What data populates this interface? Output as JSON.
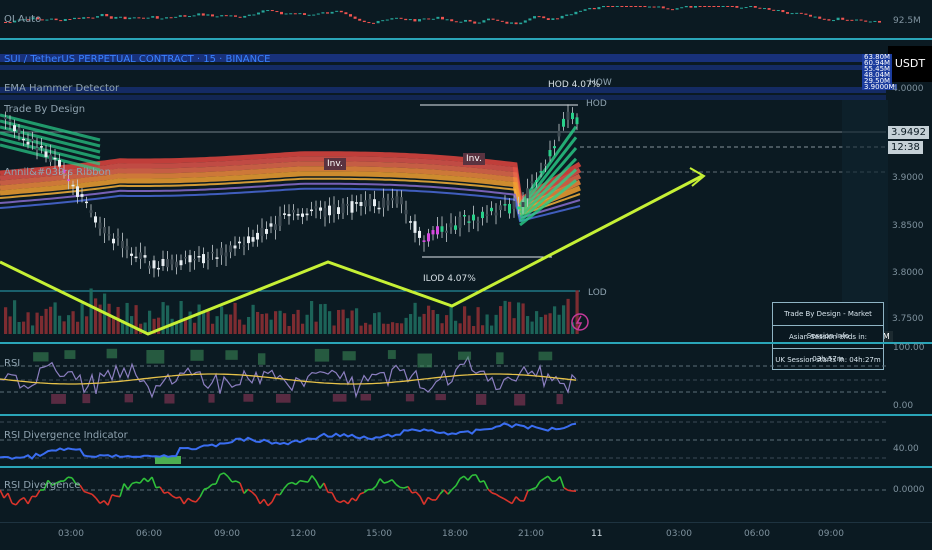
{
  "oi_pane": {
    "title": "OI Auto",
    "value": "92.5M"
  },
  "main": {
    "symbol_title": "SUI / TetherUS PERPETUAL CONTRACT · 15 · BINANCE",
    "currency_button": "USDT",
    "indicator_1": "EMA Hammer Detector",
    "indicator_2": "Trade By Design",
    "indicator_3": "Annil&#039;s Ribbon",
    "hod_label": "HOD",
    "how_label": "HOW",
    "lod_label": "LOD",
    "hod_pct": "HOD 4.07%",
    "ilod_pct": "ILOD 4.07%",
    "inv_label": "Inv.",
    "price_current": "3.9492",
    "countdown": "12:38",
    "volume_label": "5.13M",
    "right_tags": [
      "63.80M",
      "60.94M",
      "55.45M",
      "48.04M",
      "29.50M",
      "3.9000M"
    ],
    "y_ticks": [
      "4.0000",
      "3.9000",
      "3.8500",
      "3.8000",
      "3.7500"
    ]
  },
  "info_table": {
    "title": "Trade By Design - Market Session Info",
    "row1": "Asian Session ends in: 03h:57m",
    "row2": "UK Session starts in: 04h:27m"
  },
  "rsi_pane": {
    "title": "RSI",
    "top": "100.00",
    "bottom": "0.00"
  },
  "div_pane": {
    "title": "RSI Divergence Indicator",
    "value": "40.00"
  },
  "rsidiv_pane": {
    "title": "RSI Divergence",
    "value": "0.0000"
  },
  "time_axis": [
    "03:00",
    "06:00",
    "09:00",
    "12:00",
    "15:00",
    "18:00",
    "21:00",
    "11",
    "03:00",
    "06:00",
    "09:00"
  ],
  "colors": {
    "bg": "#0b1a22",
    "separator": "#2aa5b8",
    "up": "#26a69a",
    "down": "#ef5350",
    "zigzag": "#c6f035",
    "rsi": "#8c7fc0",
    "ribbon_red": "#e0453e",
    "ribbon_green": "#29d08a"
  }
}
